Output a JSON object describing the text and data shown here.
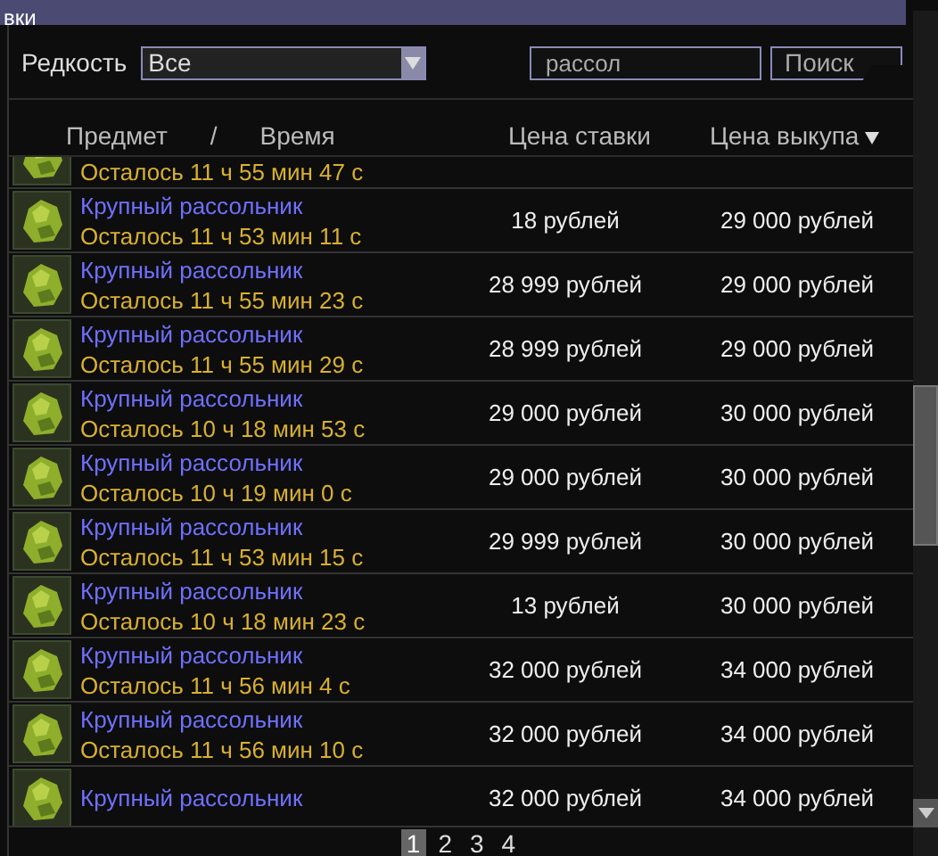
{
  "window": {
    "title": "вки"
  },
  "filters": {
    "rarity_label": "Редкость",
    "rarity_value": "Все",
    "search_value": "рассол",
    "search_button": "Поиск"
  },
  "columns": [
    {
      "label": "Предмет",
      "sorted": false
    },
    {
      "label": "/",
      "sorted": false
    },
    {
      "label": "Время",
      "sorted": false
    },
    {
      "label": "Цена ставки",
      "sorted": false
    },
    {
      "label": "Цена выкупа",
      "sorted": true
    }
  ],
  "rows": [
    {
      "time": "Осталось 11 ч 55 мин 47 с"
    },
    {
      "name": "Крупный рассольник",
      "time": "Осталось 11 ч 53 мин 11 с",
      "bid": "18 рублей",
      "buyout": "29 000 рублей"
    },
    {
      "name": "Крупный рассольник",
      "time": "Осталось 11 ч 55 мин 23 с",
      "bid": "28 999 рублей",
      "buyout": "29 000 рублей"
    },
    {
      "name": "Крупный рассольник",
      "time": "Осталось 11 ч 55 мин 29 с",
      "bid": "28 999 рублей",
      "buyout": "29 000 рублей"
    },
    {
      "name": "Крупный рассольник",
      "time": "Осталось 10 ч 18 мин 53 с",
      "bid": "29 000 рублей",
      "buyout": "30 000 рублей"
    },
    {
      "name": "Крупный рассольник",
      "time": "Осталось 10 ч 19 мин 0 с",
      "bid": "29 000 рублей",
      "buyout": "30 000 рублей"
    },
    {
      "name": "Крупный рассольник",
      "time": "Осталось 11 ч 53 мин 15 с",
      "bid": "29 999 рублей",
      "buyout": "30 000 рублей"
    },
    {
      "name": "Крупный рассольник",
      "time": "Осталось 10 ч 18 мин 23 с",
      "bid": "13 рублей",
      "buyout": "30 000 рублей"
    },
    {
      "name": "Крупный рассольник",
      "time": "Осталось 11 ч 56 мин 4 с",
      "bid": "32 000 рублей",
      "buyout": "34 000 рублей"
    },
    {
      "name": "Крупный рассольник",
      "time": "Осталось 11 ч 56 мин 10 с",
      "bid": "32 000 рублей",
      "buyout": "34 000 рублей"
    },
    {
      "name": "Крупный рассольник",
      "bid": "32 000 рублей",
      "buyout": "34 000 рублей"
    }
  ],
  "pages": [
    {
      "label": "1",
      "selected": true
    },
    {
      "label": "2",
      "selected": false
    },
    {
      "label": "3",
      "selected": false
    },
    {
      "label": "4",
      "selected": false
    }
  ]
}
